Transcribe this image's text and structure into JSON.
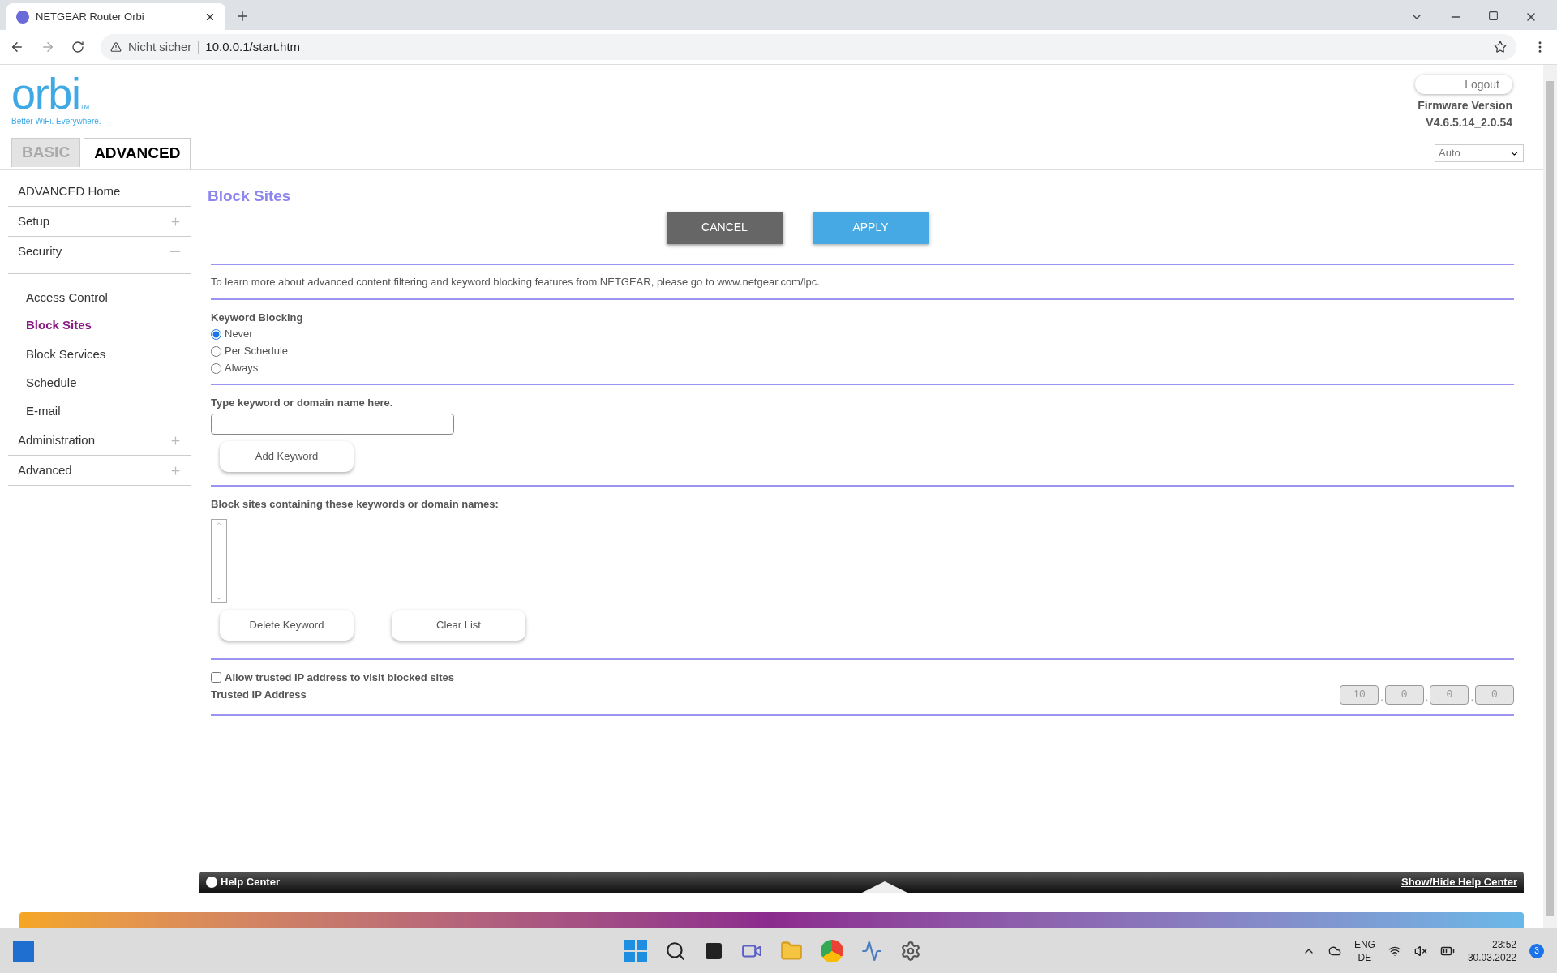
{
  "browser": {
    "tab_title": "NETGEAR Router Orbi",
    "warning": "Nicht sicher",
    "url": "10.0.0.1/start.htm"
  },
  "header": {
    "logo": "orbi",
    "tm": "TM",
    "tagline": "Better WiFi. Everywhere.",
    "logout": "Logout",
    "firmware_label": "Firmware Version",
    "firmware_version": "V4.6.5.14_2.0.54",
    "language": "Auto"
  },
  "tabs": [
    {
      "label": "BASIC",
      "selected": false
    },
    {
      "label": "ADVANCED",
      "selected": true
    }
  ],
  "sidebar": {
    "items": [
      {
        "label": "ADVANCED Home",
        "kind": "link"
      },
      {
        "label": "Setup",
        "kind": "group",
        "expanded": false
      },
      {
        "label": "Security",
        "kind": "group",
        "expanded": true,
        "children": [
          {
            "label": "Access Control",
            "selected": false
          },
          {
            "label": "Block Sites",
            "selected": true
          },
          {
            "label": "Block Services",
            "selected": false
          },
          {
            "label": "Schedule",
            "selected": false
          },
          {
            "label": "E-mail",
            "selected": false
          }
        ]
      },
      {
        "label": "Administration",
        "kind": "group",
        "expanded": false
      },
      {
        "label": "Advanced",
        "kind": "group",
        "expanded": false
      }
    ]
  },
  "page": {
    "title": "Block Sites",
    "cancel": "CANCEL",
    "apply": "APPLY",
    "info": "To learn more about advanced content filtering and keyword blocking features from NETGEAR, please go to www.netgear.com/lpc.",
    "keyword_blocking": {
      "label": "Keyword Blocking",
      "options": [
        {
          "label": "Never",
          "selected": true
        },
        {
          "label": "Per Schedule",
          "selected": false
        },
        {
          "label": "Always",
          "selected": false
        }
      ]
    },
    "keyword_label": "Type keyword or domain name here.",
    "add_keyword": "Add Keyword",
    "list_label": "Block sites containing these keywords or domain names:",
    "delete_keyword": "Delete Keyword",
    "clear_list": "Clear List",
    "allow_trusted": {
      "label": "Allow trusted IP address to visit blocked sites",
      "checked": false
    },
    "trusted_ip_label": "Trusted IP Address",
    "trusted_ip": [
      "10",
      "0",
      "0",
      "0"
    ],
    "ip_separator": "."
  },
  "help_center": {
    "title": "Help Center",
    "toggle": "Show/Hide Help Center"
  },
  "taskbar": {
    "lang": "ENG",
    "region": "DE",
    "time": "23:52",
    "date": "30.03.2022",
    "notifications": "3"
  }
}
